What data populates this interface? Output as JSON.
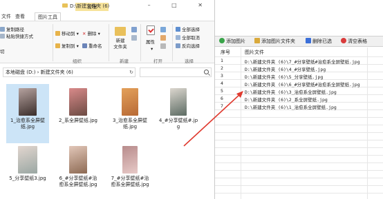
{
  "explorer": {
    "tabs": [
      "文件",
      "查看",
      "图片工具"
    ],
    "manage_label": "管理",
    "window_title": "D:\\新建文件夹 (6)",
    "window_buttons": "– □ ✕",
    "ribbon": {
      "clipboard": {
        "copy_path": "复制路径",
        "paste_shortcut": "粘贴快捷方式",
        "left_partial": "切",
        "group_label": ""
      },
      "organize": {
        "move_to": "移动到",
        "copy_to": "复制到",
        "delete": "删除",
        "rename": "重命名",
        "group_label": "组织"
      },
      "new": {
        "new_folder": "新建\n文件夹",
        "group_label": "新建"
      },
      "open": {
        "properties": "属性",
        "group_label": "打开"
      },
      "select": {
        "select_all": "全部选择",
        "select_none": "全部取消",
        "invert": "反向选择",
        "group_label": "选择"
      }
    },
    "address": "本地磁盘 (D:)  ›  新建文件夹 (6)",
    "address_prefix": "<",
    "files": [
      {
        "name": "1_治愈系全屏壁纸.jpg",
        "selected": true,
        "colors": [
          "#3a2d2a",
          "#b6a3a0"
        ]
      },
      {
        "name": "2_系全屏壁纸.jpg",
        "selected": false,
        "colors": [
          "#6c4b43",
          "#d98a8a"
        ]
      },
      {
        "name": "3_治愈系全屏壁纸.jpg",
        "selected": false,
        "colors": [
          "#b86a35",
          "#e3a05a"
        ]
      },
      {
        "name": "4_#分享壁纸#.jpg",
        "selected": false,
        "colors": [
          "#5c6b63",
          "#dcd7cf"
        ]
      },
      {
        "name": "5_分享壁纸3.jpg",
        "selected": false,
        "colors": [
          "#9aa7a3",
          "#e2d6cf"
        ]
      },
      {
        "name": "6_#分享壁纸#治愈系全屏壁纸.jpg",
        "selected": false,
        "colors": [
          "#8d6a53",
          "#e2c7b9"
        ]
      },
      {
        "name": "7_#分享壁纸#治愈系全屏壁纸.jpg",
        "selected": false,
        "colors": [
          "#e7c9c7",
          "#b88c8c"
        ]
      }
    ]
  },
  "tool": {
    "toolbar": [
      {
        "label": "添加图片",
        "icon": "add-image-icon",
        "color": "#3aa44a"
      },
      {
        "label": "添加图片文件夹",
        "icon": "add-folder-icon",
        "color": "#d9a93b"
      },
      {
        "label": "删除已选",
        "icon": "delete-selected-icon",
        "color": "#3b6fd9"
      },
      {
        "label": "清空表格",
        "icon": "clear-table-icon",
        "color": "#d93b3b"
      }
    ],
    "columns": [
      "序号",
      "图片文件"
    ],
    "rows": [
      {
        "idx": "1",
        "path": "D:\\新建文件夹 (6)\\7_#分享壁纸#治愈系全屏壁纸.jpg"
      },
      {
        "idx": "2",
        "path": "D:\\新建文件夹 (6)\\4_#分享壁纸.jpg"
      },
      {
        "idx": "3",
        "path": "D:\\新建文件夹 (6)\\5_分享壁纸.jpg"
      },
      {
        "idx": "4",
        "path": "D:\\新建文件夹 (6)\\6_#分享壁纸#治愈系全屏壁纸.jpg"
      },
      {
        "idx": "5",
        "path": "D:\\新建文件夹 (6)\\3_治愈系全屏壁纸.jpg"
      },
      {
        "idx": "6",
        "path": "D:\\新建文件夹 (6)\\2_系全屏壁纸.jpg"
      },
      {
        "idx": "7",
        "path": "D:\\新建文件夹 (6)\\1_治愈系全屏壁纸.jpg"
      }
    ]
  },
  "colors": {
    "arrow": "#e03a2f",
    "selection": "#cce4f7",
    "manage_tab": "#f7e39a"
  }
}
